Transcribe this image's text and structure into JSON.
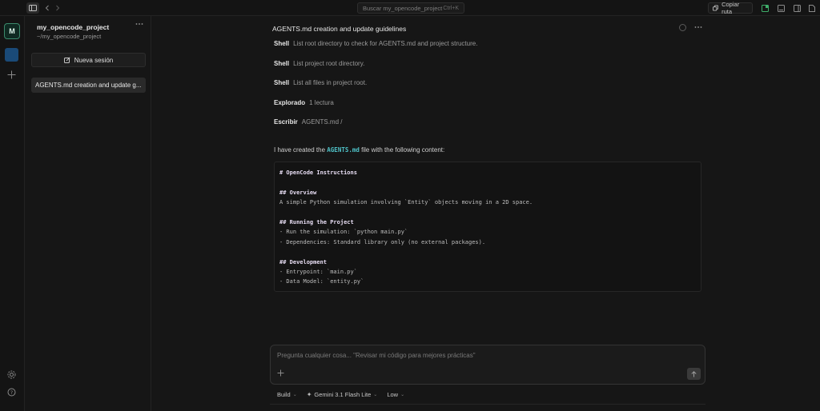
{
  "topbar": {
    "search_placeholder": "Buscar my_opencode_project",
    "search_shortcut": "Ctrl+K",
    "copy_path_label": "Copiar ruta"
  },
  "rail": {
    "avatar_letter": "M"
  },
  "sidebar": {
    "project_name": "my_opencode_project",
    "project_path": "~/my_opencode_project",
    "new_session_label": "Nueva sesión",
    "sessions": [
      {
        "label": "AGENTS.md creation and update g..."
      }
    ]
  },
  "main": {
    "title": "AGENTS.md creation and update guidelines",
    "tool_calls": [
      {
        "tool": "Shell",
        "text": "List root directory to check for AGENTS.md and project structure."
      },
      {
        "tool": "Shell",
        "text": "List project root directory."
      },
      {
        "tool": "Shell",
        "text": "List all files in project root."
      },
      {
        "tool": "Explorado",
        "text": "1 lectura"
      },
      {
        "tool": "Escribir",
        "text": "AGENTS.md  /"
      }
    ],
    "response_prefix": "I have created the",
    "response_file": "AGENTS.md",
    "response_suffix": "file with the following content:",
    "code_lines": [
      {
        "text": "# OpenCode Instructions",
        "heading": true
      },
      {
        "text": "",
        "heading": false
      },
      {
        "text": "## Overview",
        "heading": true
      },
      {
        "text": "A simple Python simulation involving `Entity` objects moving in a 2D space.",
        "heading": false
      },
      {
        "text": "",
        "heading": false
      },
      {
        "text": "## Running the Project",
        "heading": true
      },
      {
        "text": "- Run the simulation: `python main.py`",
        "heading": false
      },
      {
        "text": "- Dependencies: Standard library only (no external packages).",
        "heading": false
      },
      {
        "text": "",
        "heading": false
      },
      {
        "text": "## Development",
        "heading": true
      },
      {
        "text": "- Entrypoint: `main.py`",
        "heading": false
      },
      {
        "text": "- Data Model: `entity.py`",
        "heading": false
      }
    ]
  },
  "composer": {
    "placeholder": "Pregunta cualquier cosa... \"Revisar mi código para mejores prácticas\"",
    "agent_label": "Build",
    "model_label": "Gemini 3.1 Flash Lite",
    "effort_label": "Low"
  },
  "colors": {
    "accent_teal": "#4fc3c9",
    "avatar_border": "#3b8a6c",
    "project_blue": "#1a4a78"
  },
  "icons": [
    "sidebar-toggle-icon",
    "back-icon",
    "forward-icon",
    "copy-icon",
    "panel-icon",
    "terminal-icon",
    "panel-right-icon",
    "file-icon",
    "plus-icon",
    "settings-icon",
    "help-icon",
    "edit-icon",
    "arrow-up-icon"
  ]
}
